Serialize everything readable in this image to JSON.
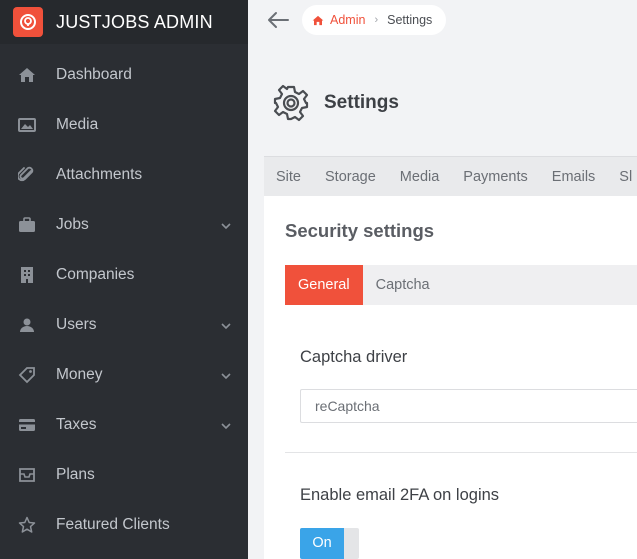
{
  "app": {
    "title": "JUSTJOBS ADMIN",
    "accent": "#f0513b"
  },
  "sidebar": {
    "items": [
      {
        "label": "Dashboard",
        "icon": "home-icon"
      },
      {
        "label": "Media",
        "icon": "image-icon"
      },
      {
        "label": "Attachments",
        "icon": "paperclip-icon"
      },
      {
        "label": "Jobs",
        "icon": "briefcase-icon",
        "expandable": true
      },
      {
        "label": "Companies",
        "icon": "building-icon"
      },
      {
        "label": "Users",
        "icon": "user-icon",
        "expandable": true
      },
      {
        "label": "Money",
        "icon": "tag-icon",
        "expandable": true
      },
      {
        "label": "Taxes",
        "icon": "credit-card-icon",
        "expandable": true
      },
      {
        "label": "Plans",
        "icon": "inbox-icon"
      },
      {
        "label": "Featured Clients",
        "icon": "star-icon"
      }
    ]
  },
  "breadcrumb": {
    "home": "Admin",
    "current": "Settings"
  },
  "page": {
    "title": "Settings"
  },
  "tabs": [
    "Site",
    "Storage",
    "Media",
    "Payments",
    "Emails",
    "Sl"
  ],
  "security": {
    "title": "Security settings",
    "subtabs": [
      "General",
      "Captcha"
    ],
    "captcha_label": "Captcha driver",
    "captcha_value": "reCaptcha",
    "twofa_label": "Enable email 2FA on logins",
    "twofa_toggle": "On"
  }
}
